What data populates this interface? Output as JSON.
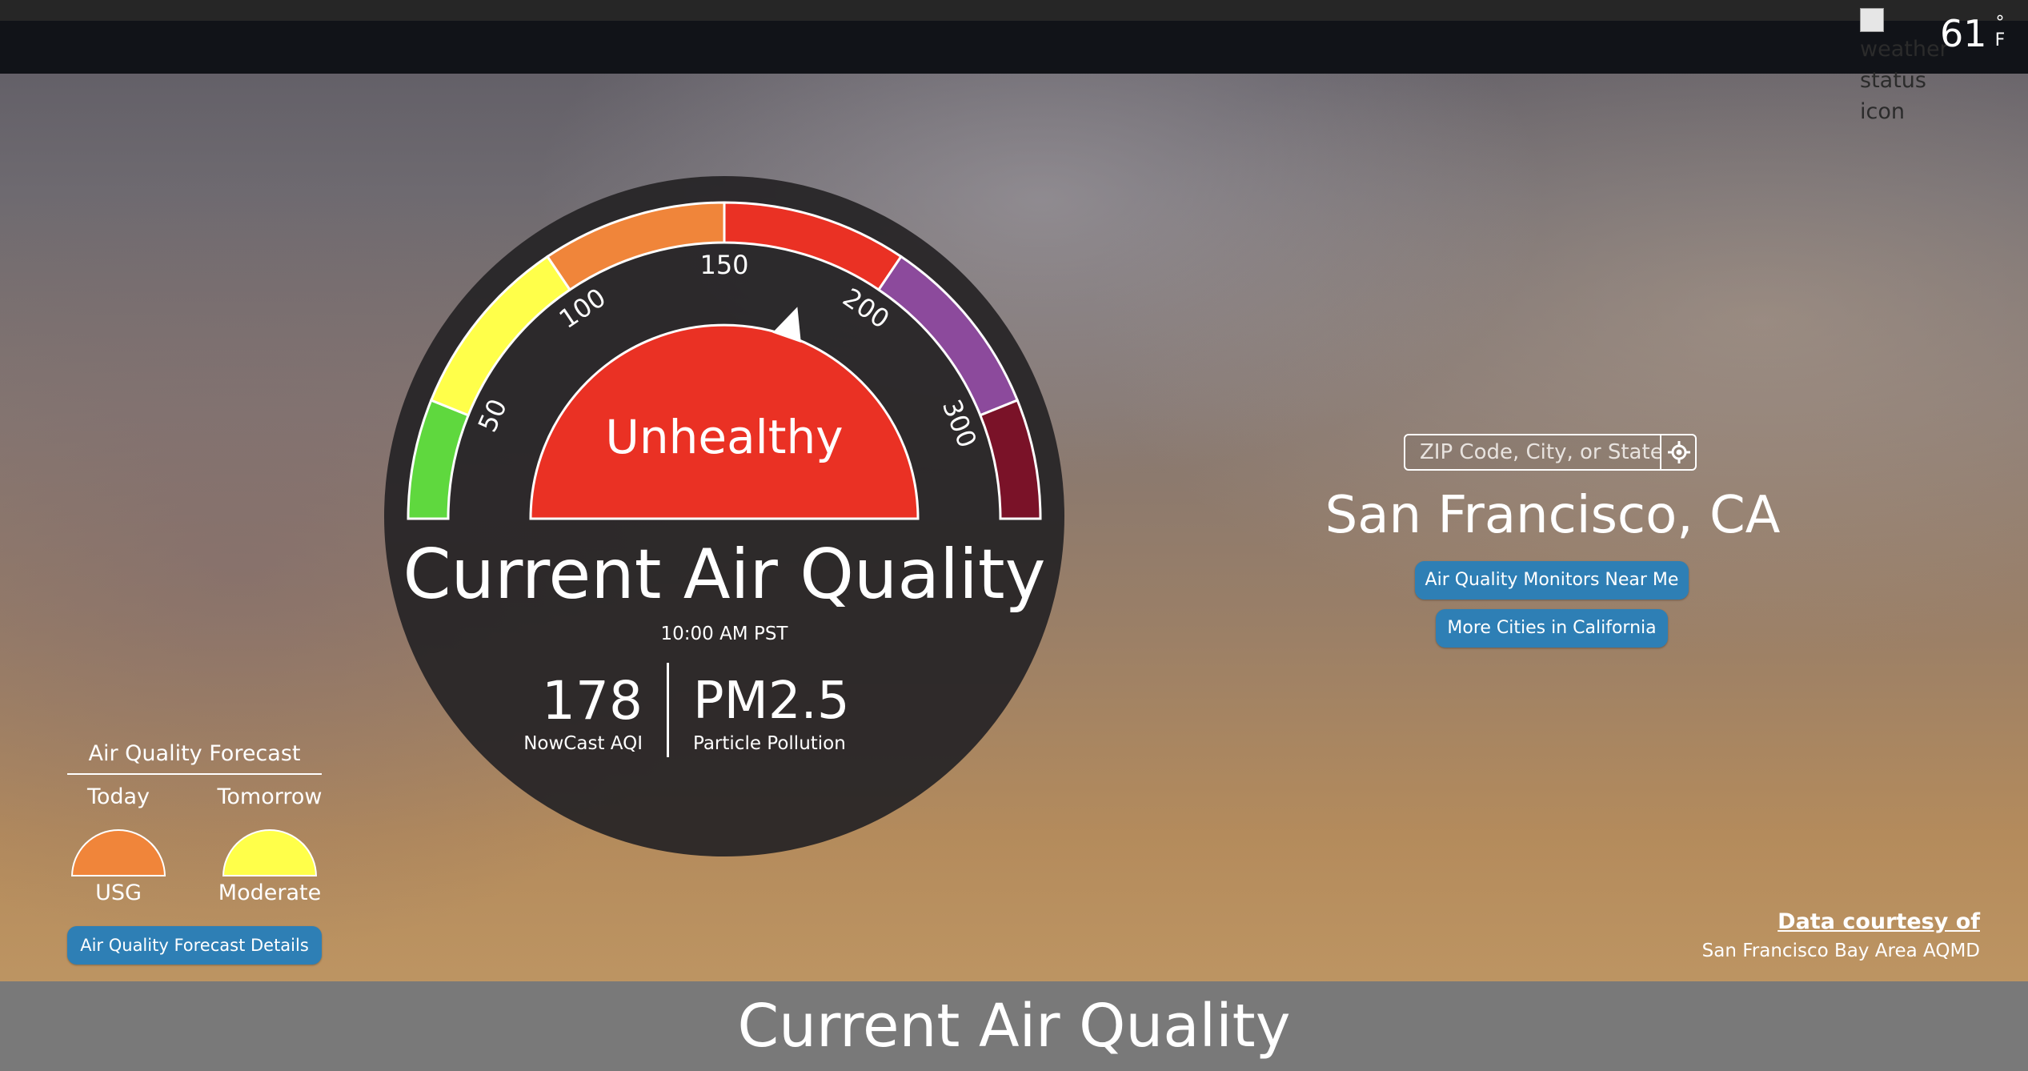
{
  "header": {
    "weather_icon_alt": "weather status icon",
    "temperature": "61",
    "temperature_unit": "°F"
  },
  "gauge": {
    "scale_labels": [
      "50",
      "100",
      "150",
      "200",
      "300"
    ],
    "category": "Unhealthy",
    "aqi_value": 178,
    "colors": {
      "good": "#5fd83e",
      "moderate": "#ffff4a",
      "usg": "#f0853a",
      "unhealthy": "#ea3124",
      "very_unhealthy": "#8c4a9c",
      "hazardous": "#7a1228"
    }
  },
  "current": {
    "title": "Current Air Quality",
    "time": "10:00 AM PST",
    "aqi_value": "178",
    "aqi_label": "NowCast AQI",
    "pollutant": "PM2.5",
    "pollutant_label": "Particle Pollution"
  },
  "search": {
    "placeholder": "ZIP Code, City, or State",
    "locate_icon": "crosshair-icon"
  },
  "location": {
    "city": "San Francisco, CA",
    "monitors_button": "Air Quality Monitors Near Me",
    "cities_button": "More Cities in California"
  },
  "forecast": {
    "title": "Air Quality Forecast",
    "today_label": "Today",
    "tomorrow_label": "Tomorrow",
    "today_category": "USG",
    "tomorrow_category": "Moderate",
    "today_color": "#f0853a",
    "tomorrow_color": "#ffff4a",
    "details_button": "Air Quality Forecast Details"
  },
  "courtesy": {
    "heading": "Data courtesy of",
    "source": "San Francisco Bay Area AQMD"
  },
  "footer": {
    "title": "Current Air Quality"
  }
}
